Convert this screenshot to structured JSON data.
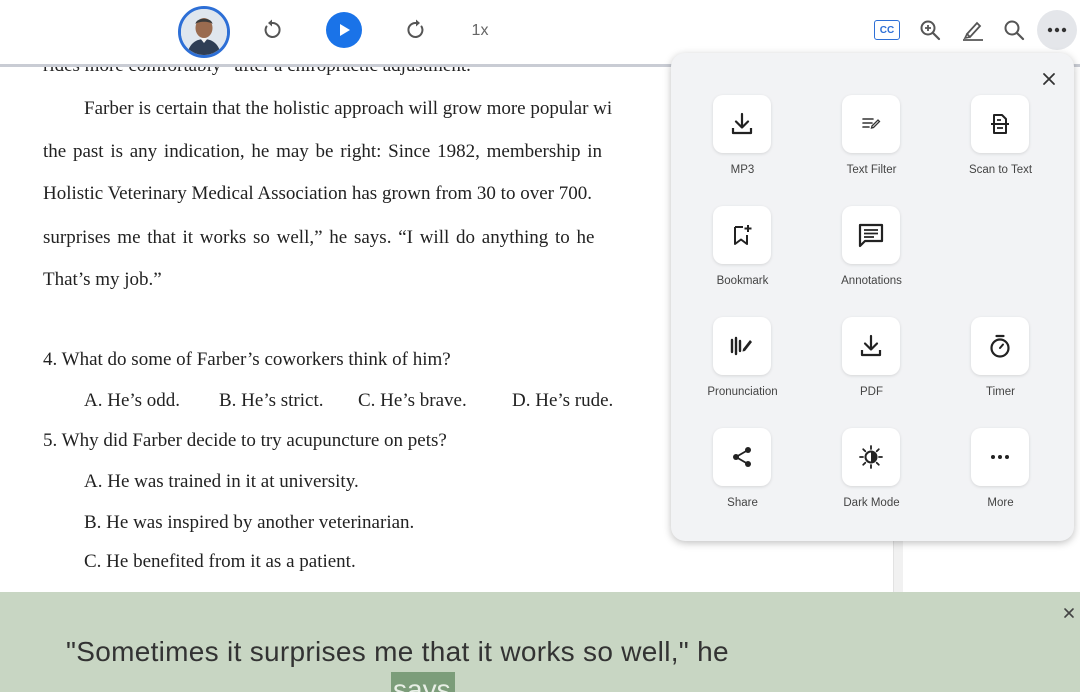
{
  "toolbar": {
    "speed_label": "1x",
    "cc_label": "CC",
    "accent_color": "#1a73e8"
  },
  "document": {
    "cut_line": "rides more comfortably” after a chiropractic adjustment.",
    "paragraph_lines": [
      "Farber is certain that the holistic approach will grow more popular wi",
      "the past is any indication, he may be right: Since 1982, membership in",
      "Holistic Veterinary Medical Association has grown from 30 to over 700.",
      "surprises me that it works so well,” he says. “I will do anything to he",
      "That’s my job.”"
    ],
    "q4": {
      "question": "4. What do some of Farber’s coworkers think of him?",
      "options": [
        "A. He’s odd.",
        "B. He’s strict.",
        "C. He’s brave.",
        "D. He’s rude."
      ]
    },
    "q5": {
      "question": "5. Why did Farber decide to try acupuncture on pets?",
      "options": [
        "A. He was trained in it at university.",
        "B. He was inspired by another veterinarian.",
        "C. He benefited from it as a patient."
      ]
    }
  },
  "menu": {
    "items": [
      {
        "label": "MP3",
        "icon": "download-icon"
      },
      {
        "label": "Text Filter",
        "icon": "text-filter-icon"
      },
      {
        "label": "Scan to Text",
        "icon": "scan-text-icon"
      },
      {
        "label": "Bookmark",
        "icon": "bookmark-add-icon"
      },
      {
        "label": "Annotations",
        "icon": "annotation-icon"
      },
      {
        "label": "Pronunciation",
        "icon": "pronunciation-icon"
      },
      {
        "label": "PDF",
        "icon": "download-icon"
      },
      {
        "label": "Timer",
        "icon": "timer-icon"
      },
      {
        "label": "Share",
        "icon": "share-icon"
      },
      {
        "label": "Dark Mode",
        "icon": "brightness-icon"
      },
      {
        "label": "More",
        "icon": "more-dots-icon"
      }
    ]
  },
  "caption": {
    "text": "\"Sometimes it surprises me that it works so well,\" he",
    "next_word": "says",
    "background_color": "#c8d6c3"
  }
}
